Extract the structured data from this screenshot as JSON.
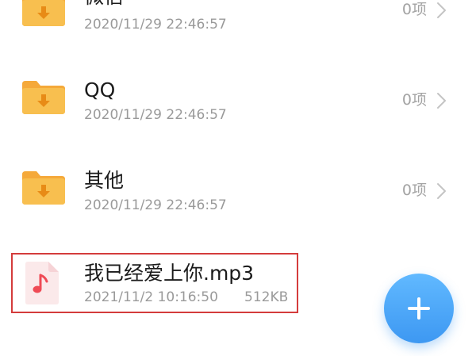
{
  "folders": [
    {
      "name": "微信",
      "date": "2020/11/29 22:46:57",
      "count": "0项"
    },
    {
      "name": "QQ",
      "date": "2020/11/29 22:46:57",
      "count": "0项"
    },
    {
      "name": "其他",
      "date": "2020/11/29 22:46:57",
      "count": "0项"
    }
  ],
  "file": {
    "name": "我已经爱上你.mp3",
    "date": "2021/11/2 10:16:50",
    "size": "512KB",
    "icon": "music-note-icon"
  },
  "icons": {
    "folder": "folder-download-icon",
    "chevron": "chevron-right-icon",
    "add": "plus-icon"
  },
  "colors": {
    "folder": "#f8bf4f",
    "folder_tab": "#f5a93a",
    "folder_arrow": "#e88b16",
    "file_icon_bg": "#fbe9ea",
    "file_icon_note": "#ef4a55",
    "highlight_border": "#d43c3c",
    "fab": "#4ea8f8"
  }
}
